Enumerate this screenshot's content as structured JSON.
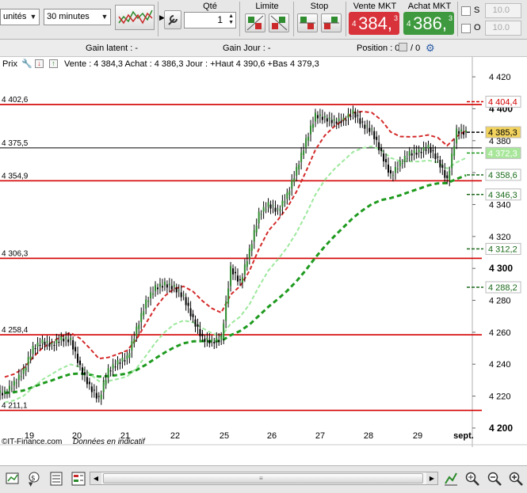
{
  "toolbar": {
    "units_select": "unités",
    "interval_select": "30 minutes",
    "qty_label": "Qté",
    "qty_value": "1",
    "limit_label": "Limite",
    "stop_label": "Stop",
    "sell": {
      "label": "Vente MKT",
      "prefix": "4",
      "value": "384,",
      "sup": "3",
      "color": "#d8323a"
    },
    "buy": {
      "label": "Achat MKT",
      "prefix": "4",
      "value": "386,",
      "sup": "3",
      "color": "#3f9a3f"
    },
    "s_label": "S",
    "o_label": "O",
    "s_value": "10.0",
    "o_value": "10.0"
  },
  "info": {
    "gain_latent": "Gain latent : -",
    "gain_jour": "Gain Jour : -",
    "position_label": "Position : 0",
    "position_sep": "/ 0"
  },
  "legend": {
    "prix": "Prix",
    "text": "Vente : 4 384,3 Achat : 4 386,3 Jour : +Haut 4 390,6 +Bas 4 379,3"
  },
  "chart_data": {
    "type": "candlestick",
    "y_axis": {
      "range": [
        4195,
        4425
      ],
      "ticks": [
        "4 420",
        "4 400",
        "4 380",
        "4 360",
        "4 340",
        "4 320",
        "4 300",
        "4 280",
        "4 260",
        "4 240",
        "4 220",
        "4 200"
      ],
      "tick_values": [
        4420,
        4400,
        4380,
        4360,
        4340,
        4320,
        4300,
        4280,
        4260,
        4240,
        4220,
        4200
      ],
      "bold_ticks": [
        "4 400",
        "4 300",
        "4 200"
      ]
    },
    "x_axis": {
      "labels": [
        "19",
        "20",
        "21",
        "22",
        "25",
        "26",
        "27",
        "28",
        "29",
        "sept."
      ]
    },
    "horizontal_levels": [
      {
        "label": "4 402,6",
        "value": 4402.6,
        "color": "#d40000"
      },
      {
        "label": "4 375,5",
        "value": 4375.5,
        "color": "#000000"
      },
      {
        "label": "4 354,9",
        "value": 4354.9,
        "color": "#d40000"
      },
      {
        "label": "4 306,3",
        "value": 4306.3,
        "color": "#d40000"
      },
      {
        "label": "4 258,4",
        "value": 4258.4,
        "color": "#d40000"
      },
      {
        "label": "4 211,1",
        "value": 4211.1,
        "color": "#d40000"
      }
    ],
    "right_tags": [
      {
        "label": "4 404,4",
        "value": 4404.4,
        "color": "#d40000",
        "bg": "#ffffff"
      },
      {
        "label": "4 385,3",
        "value": 4385.3,
        "color": "#000000",
        "bg": "#f2d35e"
      },
      {
        "label": "4 372,3",
        "value": 4372.3,
        "color": "#ffffff",
        "bg": "#a8e79a"
      },
      {
        "label": "4 358,6",
        "value": 4358.6,
        "color": "#1c6b1c",
        "bg": "#ffffff"
      },
      {
        "label": "4 346,3",
        "value": 4346.3,
        "color": "#1c6b1c",
        "bg": "#ffffff"
      },
      {
        "label": "4 312,2",
        "value": 4312.2,
        "color": "#1c6b1c",
        "bg": "#ffffff"
      },
      {
        "label": "4 288,2",
        "value": 4288.2,
        "color": "#1c6b1c",
        "bg": "#ffffff"
      }
    ],
    "close_series": [
      4222,
      4228,
      4236,
      4250,
      4254,
      4252,
      4256,
      4255,
      4238,
      4226,
      4218,
      4236,
      4241,
      4244,
      4262,
      4279,
      4288,
      4290,
      4288,
      4282,
      4268,
      4256,
      4254,
      4256,
      4300,
      4291,
      4311,
      4334,
      4340,
      4336,
      4346,
      4362,
      4380,
      4396,
      4394,
      4392,
      4393,
      4398,
      4390,
      4386,
      4372,
      4358,
      4366,
      4372,
      4373,
      4376,
      4368,
      4355,
      4386,
      4385
    ],
    "credit": "©IT-Finance.com",
    "credit_note": "Données en indicatif",
    "colors": {
      "up": "#2e8b2e",
      "down": "#000000",
      "red_line": "#d40000",
      "ma_fast": "#9de89d",
      "ma_slow": "#1e9a1e",
      "ma_red": "#d42a2a"
    }
  },
  "bottom": {
    "icons": [
      "chart-tools-icon",
      "indicator-icon",
      "print-icon",
      "export-icon",
      "scroll-left-icon",
      "scroll-right-icon",
      "drawing-icon",
      "zoom-fit-icon",
      "zoom-out-icon",
      "zoom-in-icon"
    ]
  }
}
